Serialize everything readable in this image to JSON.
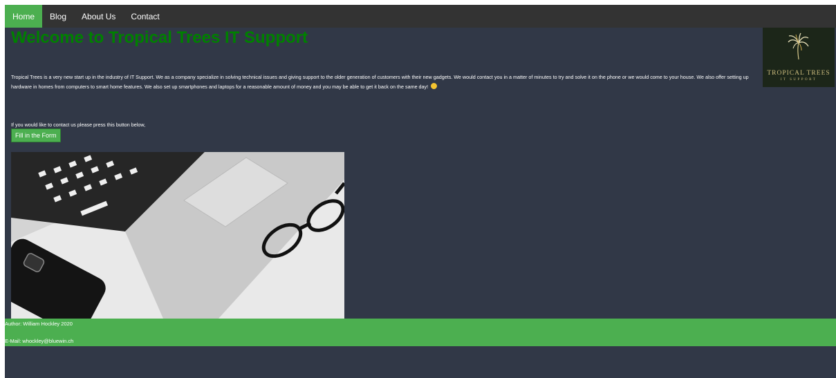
{
  "nav": {
    "items": [
      {
        "label": "Home"
      },
      {
        "label": "Blog"
      },
      {
        "label": "About Us"
      },
      {
        "label": "Contact"
      }
    ]
  },
  "header": {
    "title": "Welcome to Tropical Trees IT Support"
  },
  "logo": {
    "name": "TROPICAL TREES",
    "subtitle": "IT SUPPORT",
    "icon": "palm-tree-icon"
  },
  "main": {
    "intro": "Tropical Trees is a very new start up in the industry of IT Support. We as a company specialize in solving technical issues and giving support to the older generation of customers with their new gadgets. We would contact you in a matter of minutes to try and solve it on the phone or we would come to your house. We also offer setting up hardware in homes from computers to smart home features. We also set up smartphones and laptops for a reasonable amount of money and you may be able to get it back on the same day!",
    "contact_prompt": "If you would like to contact us please press this button below,",
    "form_button": "Fill in the Form"
  },
  "footer": {
    "author": "Author: William Hockley 2020",
    "email": "E-Mail: whockley@bluewin.ch"
  },
  "colors": {
    "nav_background": "#333333",
    "accent": "#4caf50",
    "page_background": "#313847",
    "title": "#008000"
  }
}
